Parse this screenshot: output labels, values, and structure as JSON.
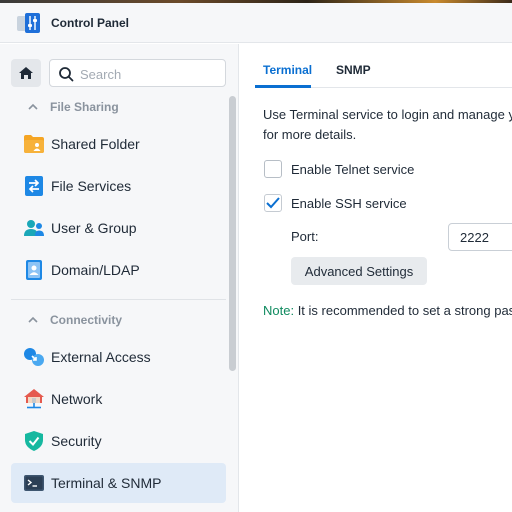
{
  "window": {
    "title": "Control Panel",
    "app_icon": "control-panel-sliders-icon"
  },
  "search": {
    "placeholder": "Search",
    "value": ""
  },
  "sidebar": {
    "sections": [
      {
        "label": "File Sharing",
        "items": [
          {
            "label": "Shared Folder",
            "icon": "folder-share-icon",
            "color": "#f5a524"
          },
          {
            "label": "File Services",
            "icon": "file-services-icon",
            "color": "#1e88e5"
          },
          {
            "label": "User & Group",
            "icon": "user-group-icon",
            "color": "#1aa7b8"
          },
          {
            "label": "Domain/LDAP",
            "icon": "domain-ldap-icon",
            "color": "#1e88e5"
          }
        ]
      },
      {
        "label": "Connectivity",
        "items": [
          {
            "label": "External Access",
            "icon": "external-access-icon",
            "color": "#1e88e5"
          },
          {
            "label": "Network",
            "icon": "network-house-icon",
            "color": "#e55a4e"
          },
          {
            "label": "Security",
            "icon": "security-shield-icon",
            "color": "#16b8a0"
          },
          {
            "label": "Terminal & SNMP",
            "icon": "terminal-icon",
            "color": "#3e5670",
            "active": true
          }
        ]
      }
    ]
  },
  "tabs": [
    {
      "label": "Terminal",
      "active": true
    },
    {
      "label": "SNMP",
      "active": false
    }
  ],
  "terminal": {
    "description_line1": "Use Terminal service to login and manage y",
    "description_line2": "for more details.",
    "telnet": {
      "label": "Enable Telnet service",
      "checked": false
    },
    "ssh": {
      "label": "Enable SSH service",
      "checked": true
    },
    "port_label": "Port:",
    "port_value": "2222",
    "advanced_button": "Advanced Settings",
    "note_key": "Note:",
    "note_text": " It is recommended to set a strong pas"
  },
  "colors": {
    "accent": "#0a6fd1",
    "note": "#0f8a5f",
    "active_nav_bg": "#dfeaf7"
  }
}
